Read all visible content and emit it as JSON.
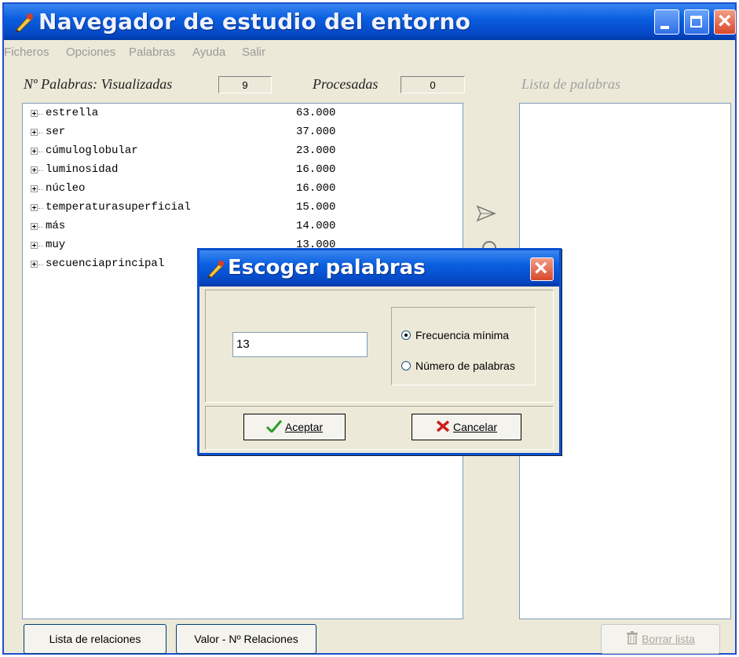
{
  "window": {
    "title": "Navegador de estudio del entorno"
  },
  "menu": [
    "Ficheros",
    "Opciones",
    "Palabras",
    "Ayuda",
    "Salir"
  ],
  "header": {
    "visualizadas_label": "Nº Palabras: Visualizadas",
    "visualizadas_count": "9",
    "procesadas_label": "Procesadas",
    "procesadas_count": "0"
  },
  "word_tree": [
    {
      "word": "estrella",
      "freq": "63.000"
    },
    {
      "word": "ser",
      "freq": "37.000"
    },
    {
      "word": "cúmuloglobular",
      "freq": "23.000"
    },
    {
      "word": "luminosidad",
      "freq": "16.000"
    },
    {
      "word": "núcleo",
      "freq": "16.000"
    },
    {
      "word": "temperaturasuperficial",
      "freq": "15.000"
    },
    {
      "word": "más",
      "freq": "14.000"
    },
    {
      "word": "muy",
      "freq": "13.000"
    },
    {
      "word": "secuenciaprincipal",
      "freq": ""
    }
  ],
  "list_panel": {
    "title": "Lista de palabras"
  },
  "buttons": {
    "relaciones": "Lista de relaciones",
    "valor": "Valor - Nº Relaciones",
    "borrar": "Borrar lista"
  },
  "dialog": {
    "title": "Escoger palabras",
    "input_value": "13",
    "option_freq": "Frecuencia mínima",
    "option_num": "Número de palabras",
    "accept": "Aceptar",
    "cancel": "Cancelar"
  },
  "colors": {
    "titlebar": "#0a5fe0",
    "face": "#ece9d8"
  }
}
